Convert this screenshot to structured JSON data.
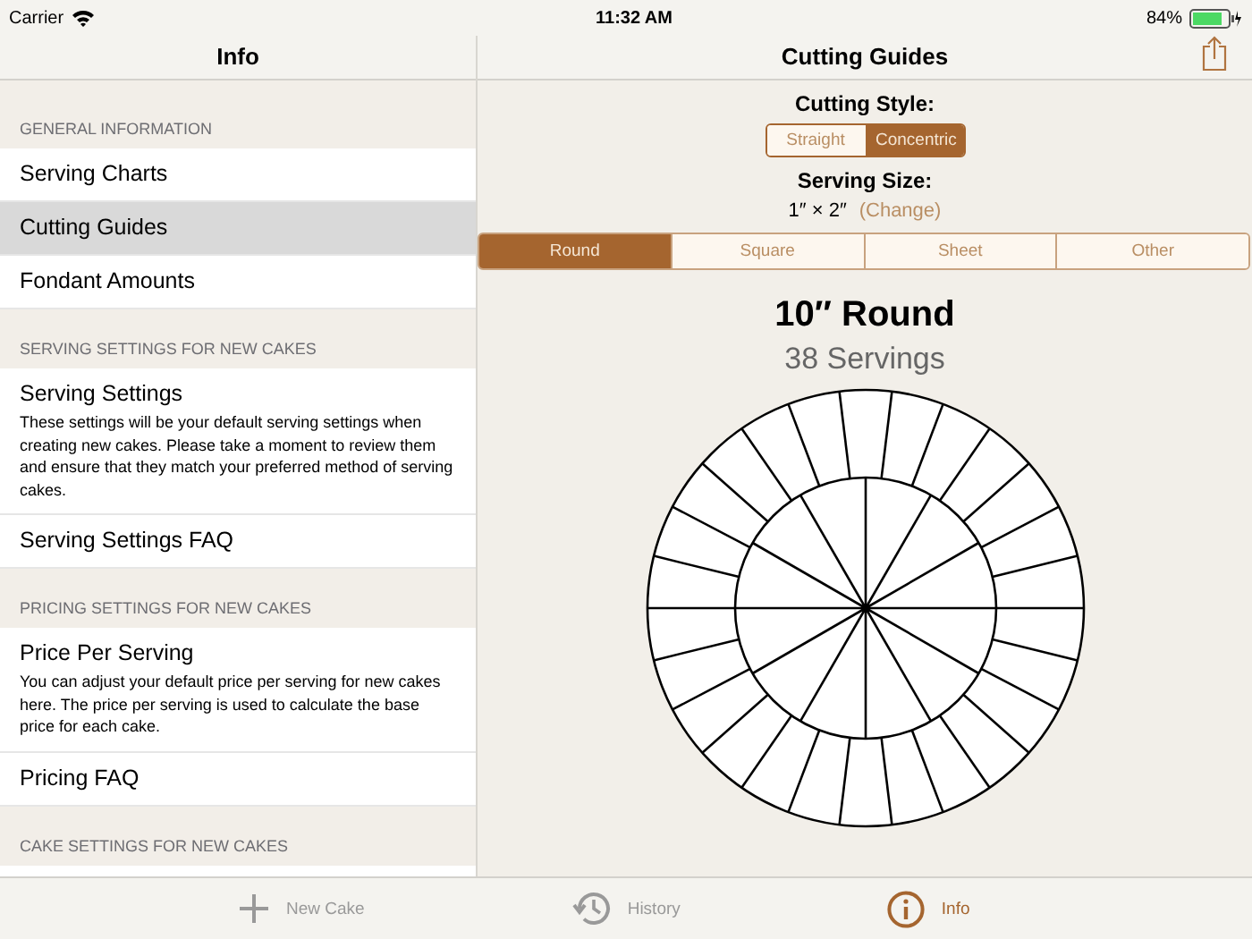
{
  "status_bar": {
    "carrier": "Carrier",
    "time": "11:32 AM",
    "battery": "84%"
  },
  "sidebar": {
    "title": "Info",
    "sections": [
      {
        "header": "GENERAL INFORMATION",
        "items": [
          {
            "label": "Serving Charts",
            "selected": false
          },
          {
            "label": "Cutting Guides",
            "selected": true
          },
          {
            "label": "Fondant Amounts",
            "selected": false
          }
        ]
      },
      {
        "header": "SERVING SETTINGS FOR NEW CAKES",
        "items": [
          {
            "label": "Serving Settings",
            "description": "These settings will be your default serving settings when creating new cakes. Please take a moment to review them and ensure that they match your preferred method of serving cakes.",
            "selected": false
          },
          {
            "label": "Serving Settings FAQ",
            "selected": false
          }
        ]
      },
      {
        "header": "PRICING SETTINGS FOR NEW CAKES",
        "items": [
          {
            "label": "Price Per Serving",
            "description": "You can adjust your default price per serving for new cakes here. The price per serving is used to calculate the base price for each cake.",
            "selected": false
          },
          {
            "label": "Pricing FAQ",
            "selected": false
          }
        ]
      },
      {
        "header": "CAKE SETTINGS FOR NEW CAKES"
      }
    ]
  },
  "detail": {
    "title": "Cutting Guides",
    "cutting_style_label": "Cutting Style:",
    "cutting_styles": [
      {
        "label": "Straight",
        "selected": false
      },
      {
        "label": "Concentric",
        "selected": true
      }
    ],
    "serving_size_label": "Serving Size:",
    "serving_size": "1″ × 2″",
    "change_link": "(Change)",
    "shape_tabs": [
      {
        "label": "Round",
        "selected": true
      },
      {
        "label": "Square",
        "selected": false
      },
      {
        "label": "Sheet",
        "selected": false
      },
      {
        "label": "Other",
        "selected": false
      }
    ],
    "cake_title": "10″ Round",
    "servings": "38 Servings"
  },
  "tab_bar": [
    {
      "label": "New Cake",
      "kind": "plus",
      "selected": false
    },
    {
      "label": "History",
      "kind": "history",
      "selected": false
    },
    {
      "label": "Info",
      "kind": "info",
      "selected": true
    }
  ]
}
